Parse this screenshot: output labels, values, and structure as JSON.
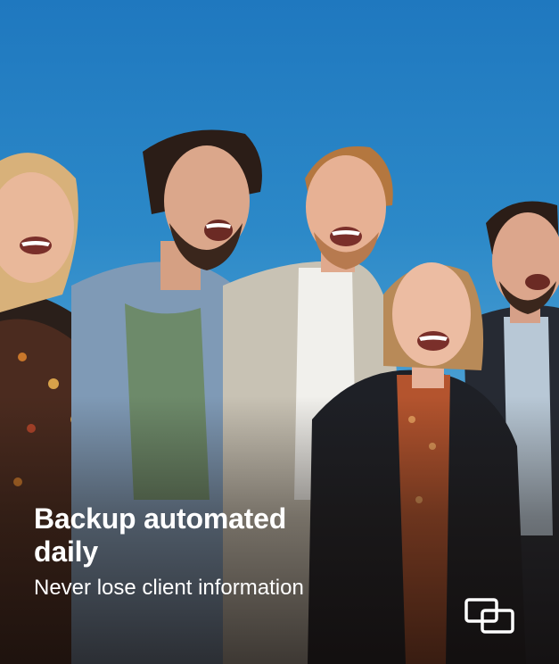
{
  "promo": {
    "headline_line1": "Backup automated",
    "headline_line2": "daily",
    "subline": "Never lose client information"
  },
  "brand": {
    "logo_icon": "linked-squares-icon",
    "text_color": "#ffffff",
    "sky_color": "#2c89c8"
  }
}
